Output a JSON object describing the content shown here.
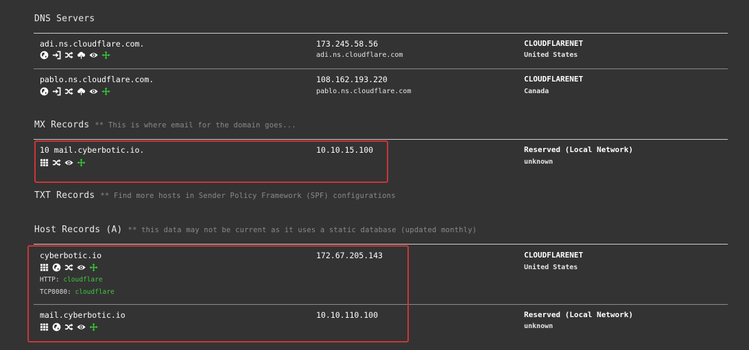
{
  "dns": {
    "title": "DNS Servers",
    "rows": [
      {
        "name": "adi.ns.cloudflare.com.",
        "ip": "173.245.58.56",
        "reverse": "adi.ns.cloudflare.com",
        "asn": "CLOUDFLARENET",
        "country": "United States"
      },
      {
        "name": "pablo.ns.cloudflare.com.",
        "ip": "108.162.193.220",
        "reverse": "pablo.ns.cloudflare.com",
        "asn": "CLOUDFLARENET",
        "country": "Canada"
      }
    ]
  },
  "mx": {
    "title": "MX Records",
    "note": "** This is where email for the domain goes...",
    "rows": [
      {
        "name": "10 mail.cyberbotic.io.",
        "ip": "10.10.15.100",
        "asn": "Reserved (Local Network)",
        "country": "unknown"
      }
    ]
  },
  "txt": {
    "title": "TXT Records",
    "note": "** Find more hosts in Sender Policy Framework (SPF) configurations"
  },
  "host": {
    "title": "Host Records (A)",
    "note": "** this data may not be current as it uses a static database (updated monthly)",
    "rows": [
      {
        "name": "cyberbotic.io",
        "ip": "172.67.205.143",
        "asn": "CLOUDFLARENET",
        "country": "United States",
        "banners": [
          {
            "label": "HTTP:",
            "value": "cloudflare"
          },
          {
            "label": "TCP8080:",
            "value": "cloudflare"
          }
        ]
      },
      {
        "name": "mail.cyberbotic.io",
        "ip": "10.10.110.100",
        "asn": "Reserved (Local Network)",
        "country": "unknown"
      }
    ]
  },
  "colors": {
    "background": "#333333",
    "accent_green": "#3ec93e",
    "highlight_box": "#c8373b"
  },
  "icons": [
    "grid-icon",
    "globe-icon",
    "signin-icon",
    "shuffle-icon",
    "cloud-upload-icon",
    "eye-icon",
    "crosshair-icon"
  ]
}
